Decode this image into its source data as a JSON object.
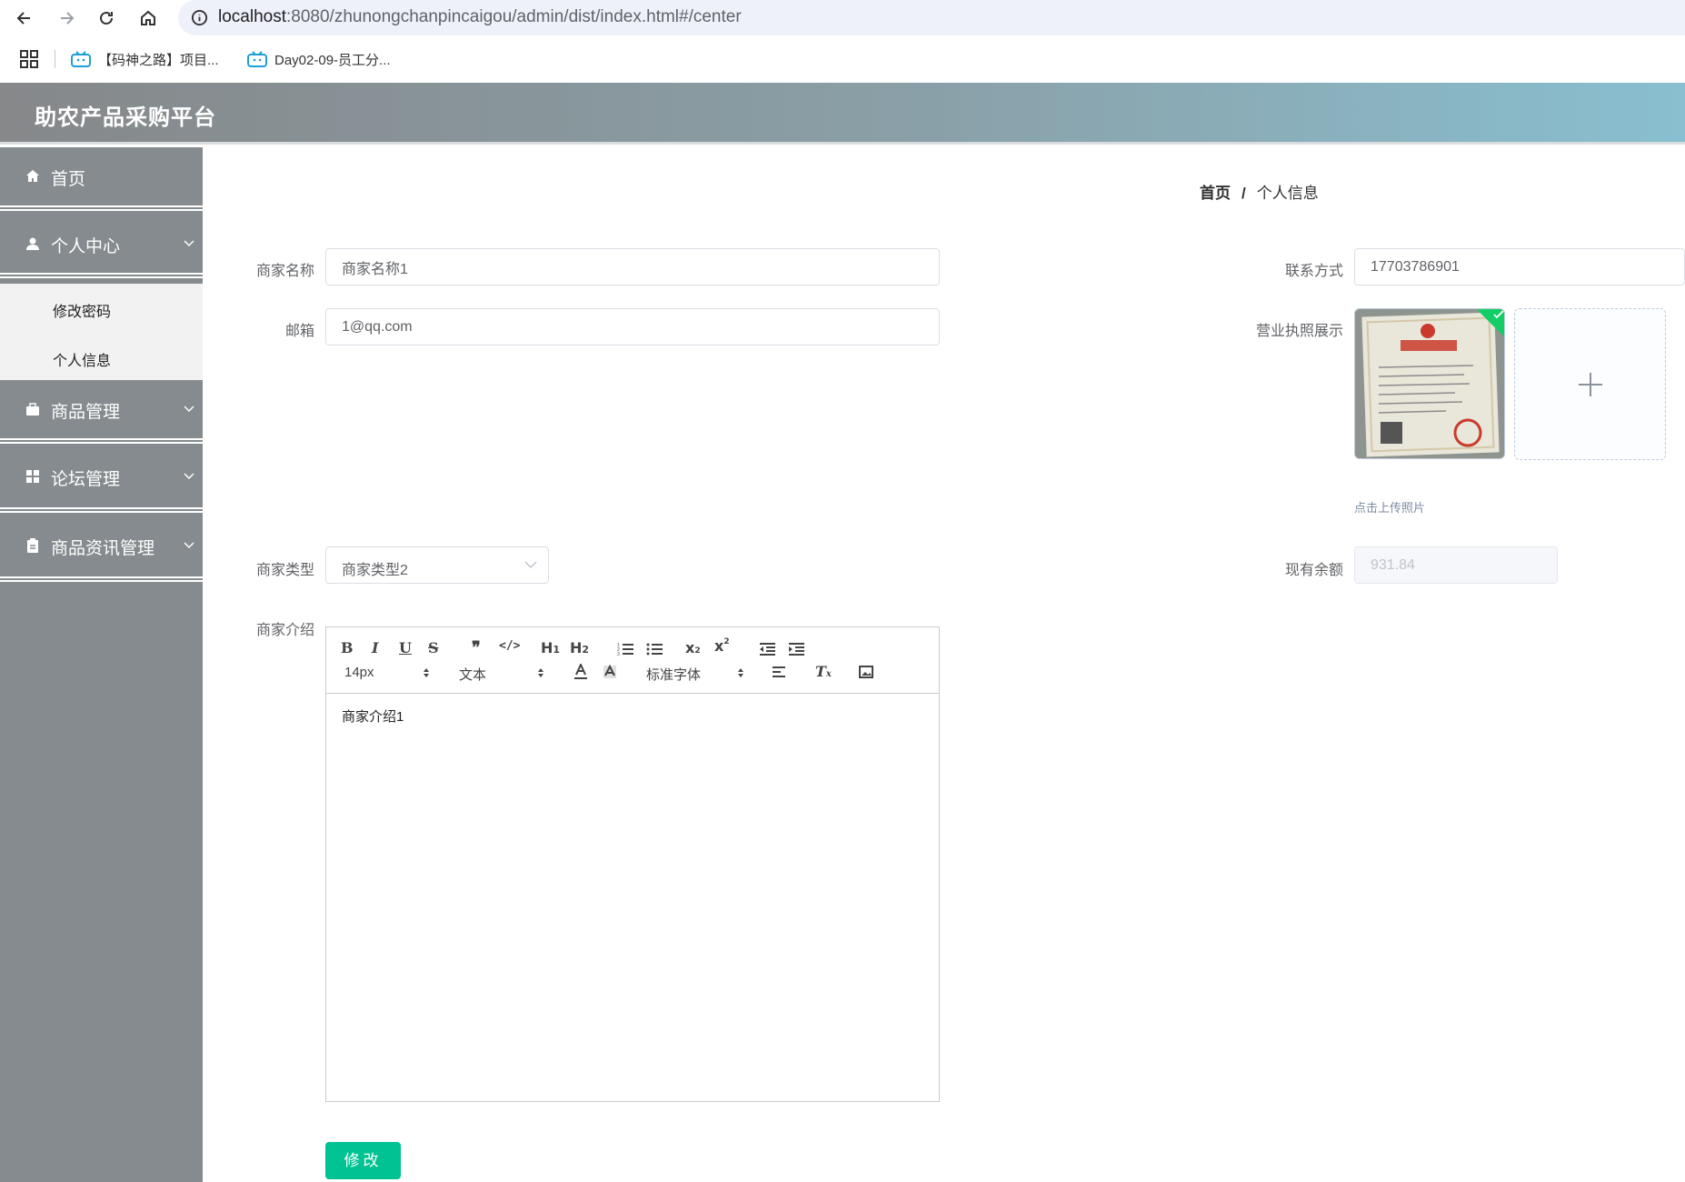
{
  "browser": {
    "url_host": "localhost",
    "url_rest": ":8080/zhunongchanpincaigou/admin/dist/index.html#/center",
    "bookmarks": [
      "【码神之路】项目...",
      "Day02-09-员工分..."
    ]
  },
  "app": {
    "title": "助农产品采购平台"
  },
  "sidebar": {
    "items": [
      {
        "label": "首页",
        "icon": "home-icon"
      },
      {
        "label": "个人中心",
        "icon": "user-icon"
      },
      {
        "label": "商品管理",
        "icon": "briefcase-icon"
      },
      {
        "label": "论坛管理",
        "icon": "grid-icon"
      },
      {
        "label": "商品资讯管理",
        "icon": "clipboard-icon"
      }
    ],
    "submenu": [
      "修改密码",
      "个人信息"
    ]
  },
  "breadcrumb": {
    "home": "首页",
    "separator": "/",
    "current": "个人信息"
  },
  "form": {
    "merchant_name_label": "商家名称",
    "merchant_name_value": "商家名称1",
    "email_label": "邮箱",
    "email_value": "1@qq.com",
    "contact_label": "联系方式",
    "contact_value": "17703786901",
    "license_label": "营业执照展示",
    "upload_tip": "点击上传照片",
    "type_label": "商家类型",
    "type_value": "商家类型2",
    "balance_label": "现有余额",
    "balance_value": "931.84",
    "intro_label": "商家介绍",
    "intro_content": "商家介绍1",
    "submit_label": "修改"
  },
  "editor": {
    "size_picker": "14px",
    "header_picker": "文本",
    "font_picker": "标准字体"
  },
  "colors": {
    "accent": "#00c292",
    "sidebar_bg": "#858b8e",
    "upload_success": "#13ce66"
  }
}
